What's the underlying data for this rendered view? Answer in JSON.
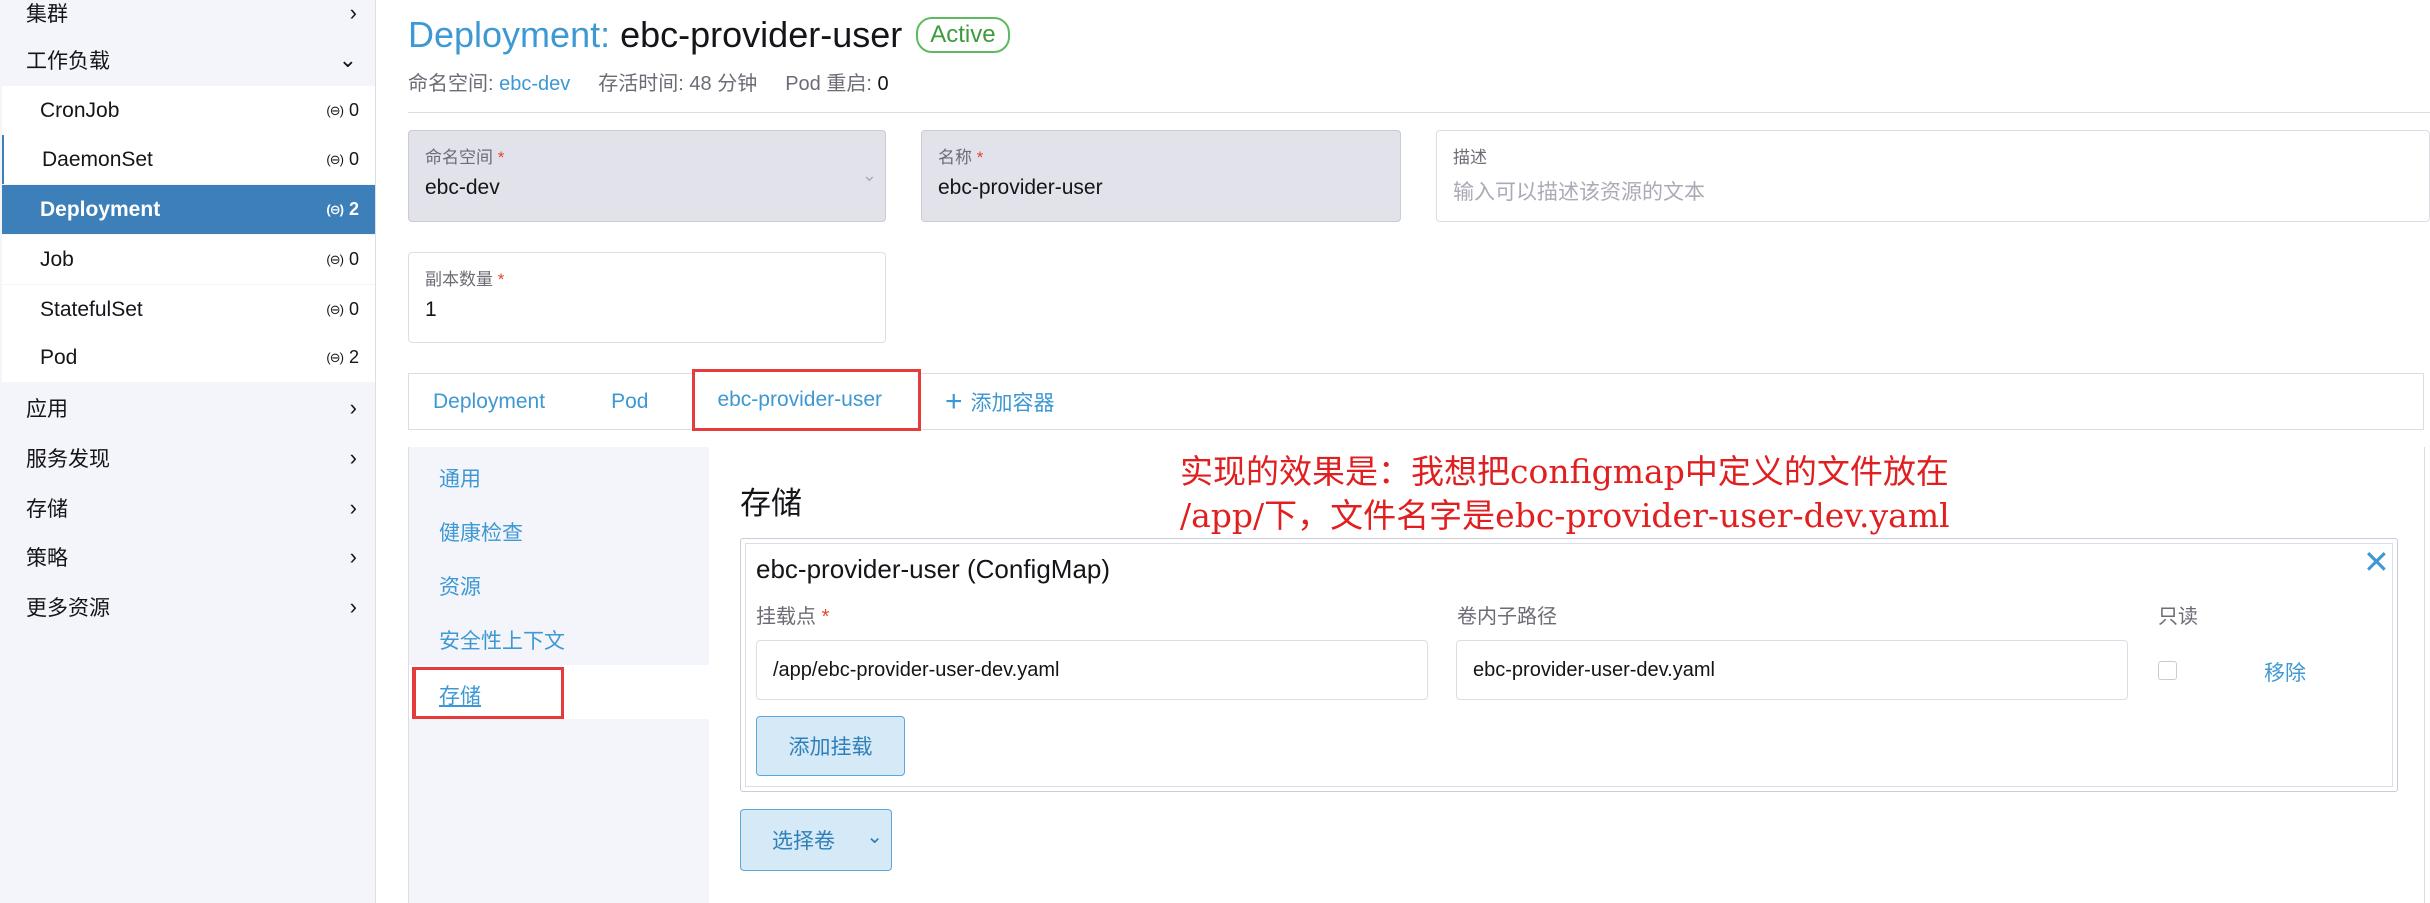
{
  "sidebar": {
    "groups_top": [
      {
        "label": "集群"
      },
      {
        "label": "工作负载"
      }
    ],
    "workloads": [
      {
        "label": "CronJob",
        "count": "0"
      },
      {
        "label": "DaemonSet",
        "count": "0"
      },
      {
        "label": "Deployment",
        "count": "2"
      },
      {
        "label": "Job",
        "count": "0"
      },
      {
        "label": "StatefulSet",
        "count": "0"
      },
      {
        "label": "Pod",
        "count": "2"
      }
    ],
    "groups_bottom": [
      {
        "label": "应用"
      },
      {
        "label": "服务发现"
      },
      {
        "label": "存储"
      },
      {
        "label": "策略"
      },
      {
        "label": "更多资源"
      }
    ]
  },
  "header": {
    "kind": "Deployment:",
    "name": "ebc-provider-user",
    "status": "Active",
    "namespace_label": "命名空间:",
    "namespace_value": "ebc-dev",
    "age_text": "存活时间: 48 分钟",
    "restarts_label": "Pod 重启:",
    "restarts_value": "0"
  },
  "form": {
    "namespace": {
      "label": "命名空间",
      "value": "ebc-dev"
    },
    "name": {
      "label": "名称",
      "value": "ebc-provider-user"
    },
    "description": {
      "label": "描述",
      "placeholder": "输入可以描述该资源的文本"
    },
    "replicas": {
      "label": "副本数量",
      "value": "1"
    }
  },
  "tabs": {
    "items": [
      {
        "label": "Deployment"
      },
      {
        "label": "Pod"
      },
      {
        "label": "ebc-provider-user"
      }
    ],
    "add_container": "添加容器"
  },
  "side_nav": {
    "items": [
      {
        "label": "通用"
      },
      {
        "label": "健康检查"
      },
      {
        "label": "资源"
      },
      {
        "label": "安全性上下文"
      },
      {
        "label": "存储"
      }
    ]
  },
  "storage": {
    "heading": "存储",
    "volume_title": "ebc-provider-user (ConfigMap)",
    "mount_point_label": "挂载点",
    "sub_path_label": "卷内子路径",
    "readonly_label": "只读",
    "mount_point_value": "/app/ebc-provider-user-dev.yaml",
    "sub_path_value": "ebc-provider-user-dev.yaml",
    "remove_label": "移除",
    "add_mount_button": "添加挂载",
    "select_volume_button": "选择卷"
  },
  "annotation": {
    "line1": "实现的效果是：我想把configmap中定义的文件放在",
    "line2": "/app/下，文件名字是ebc-provider-user-dev.yaml"
  },
  "colors": {
    "accent": "#3d98d3",
    "active_nav": "#3d7fb8",
    "highlight": "#e53b3b",
    "status_green": "#5dbb5d"
  }
}
